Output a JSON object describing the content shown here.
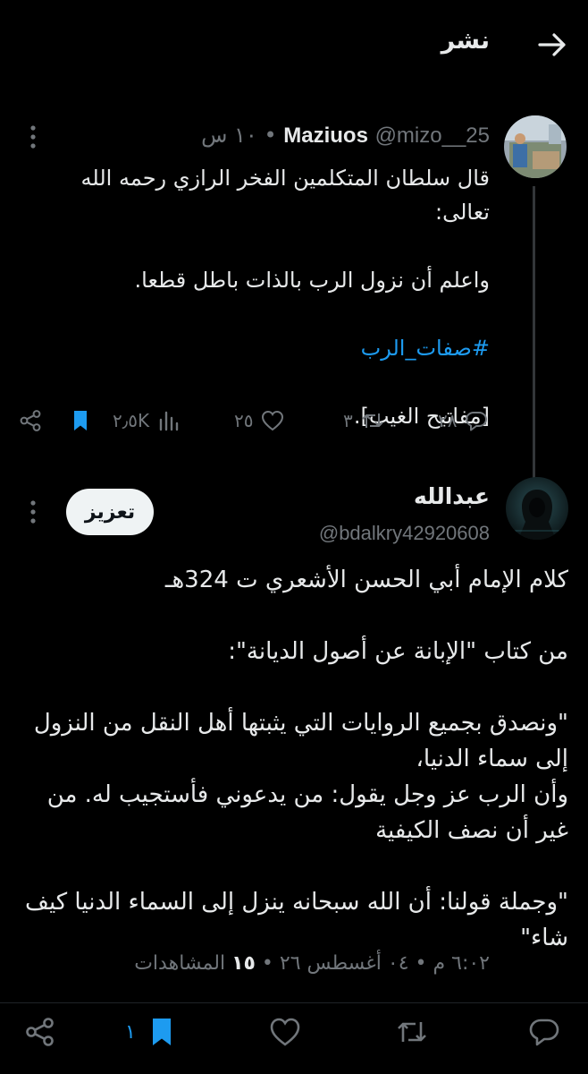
{
  "header": {
    "title": "نشر",
    "back_icon": "arrow-right-icon"
  },
  "tweet1": {
    "display_name": "Maziuos",
    "handle": "@mizo__25",
    "separator": "•",
    "time": "١٠ س",
    "body": [
      "قال سلطان المتكلمين الفخر الرازي رحمه الله تعالى:",
      "واعلم أن نزول الرب بالذات باطل قطعا.",
      "#صفات_الرب",
      "[مفاتيح الغيب]."
    ],
    "actions": {
      "replies": "٢٨",
      "retweets": "٣",
      "likes": "٢٥",
      "views": "٢٫٥K"
    }
  },
  "tweet2": {
    "display_name": "عبدالله",
    "handle": "@bdalkry42920608",
    "boost_label": "تعزيز",
    "body": [
      "كلام الإمام أبي الحسن الأشعري ت 324هـ",
      "من كتاب \"الإبانة عن أصول الديانة\":",
      "\"ونصدق بجميع الروايات التي يثبتها أهل النقل من النزول إلى سماء الدنيا،",
      "وأن الرب عز وجل يقول: من يدعوني فأستجيب له. من غير أن نصف الكيفية",
      "\"وجملة قولنا: أن الله سبحانه ينزل إلى السماء الدنيا كيف شاء\""
    ],
    "meta": {
      "time": "٦:٠٢ م",
      "date": "٠٤ أغسطس ٢٦",
      "views_count": "١٥",
      "views_label": "المشاهدات",
      "separator": "•"
    },
    "actions": {
      "bookmarks": "١"
    }
  },
  "colors": {
    "background": "#000000",
    "accent": "#1d9bf0",
    "muted": "#71767b",
    "text": "#e7e9ea"
  }
}
